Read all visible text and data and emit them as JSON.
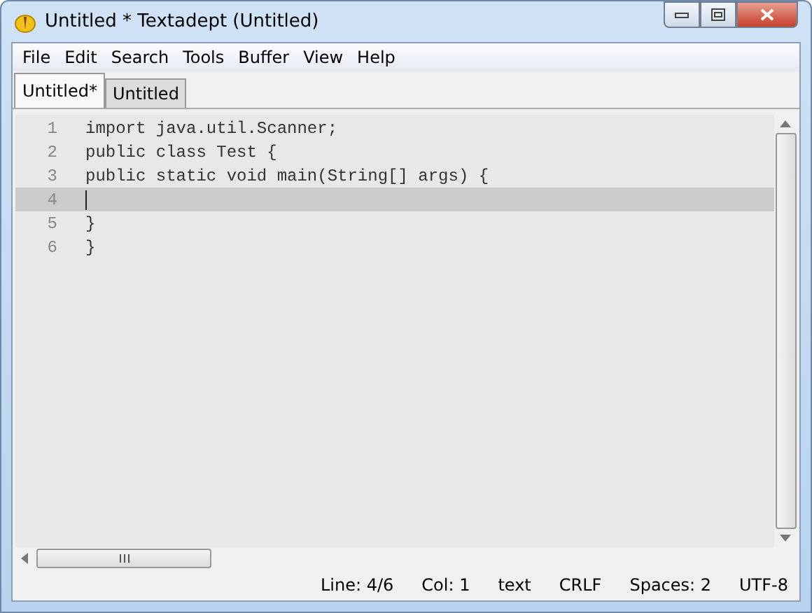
{
  "window": {
    "title": "Untitled * Textadept (Untitled)"
  },
  "menu": [
    "File",
    "Edit",
    "Search",
    "Tools",
    "Buffer",
    "View",
    "Help"
  ],
  "tabs": [
    {
      "label": "Untitled*",
      "selected": true
    },
    {
      "label": "Untitled",
      "selected": false
    }
  ],
  "editor": {
    "lines": [
      {
        "number": "1",
        "text": "import java.util.Scanner;",
        "current": false
      },
      {
        "number": "2",
        "text": "public class Test {",
        "current": false
      },
      {
        "number": "3",
        "text": "public static void main(String[] args) {",
        "current": false
      },
      {
        "number": "4",
        "current": true
      },
      {
        "number": "5",
        "text": "}",
        "current": false
      },
      {
        "number": "6",
        "text": "}",
        "current": false
      }
    ]
  },
  "status_bar": [
    "Line: 4/6",
    "Col: 1",
    "text",
    "CRLF",
    "Spaces: 2",
    "UTF-8"
  ]
}
